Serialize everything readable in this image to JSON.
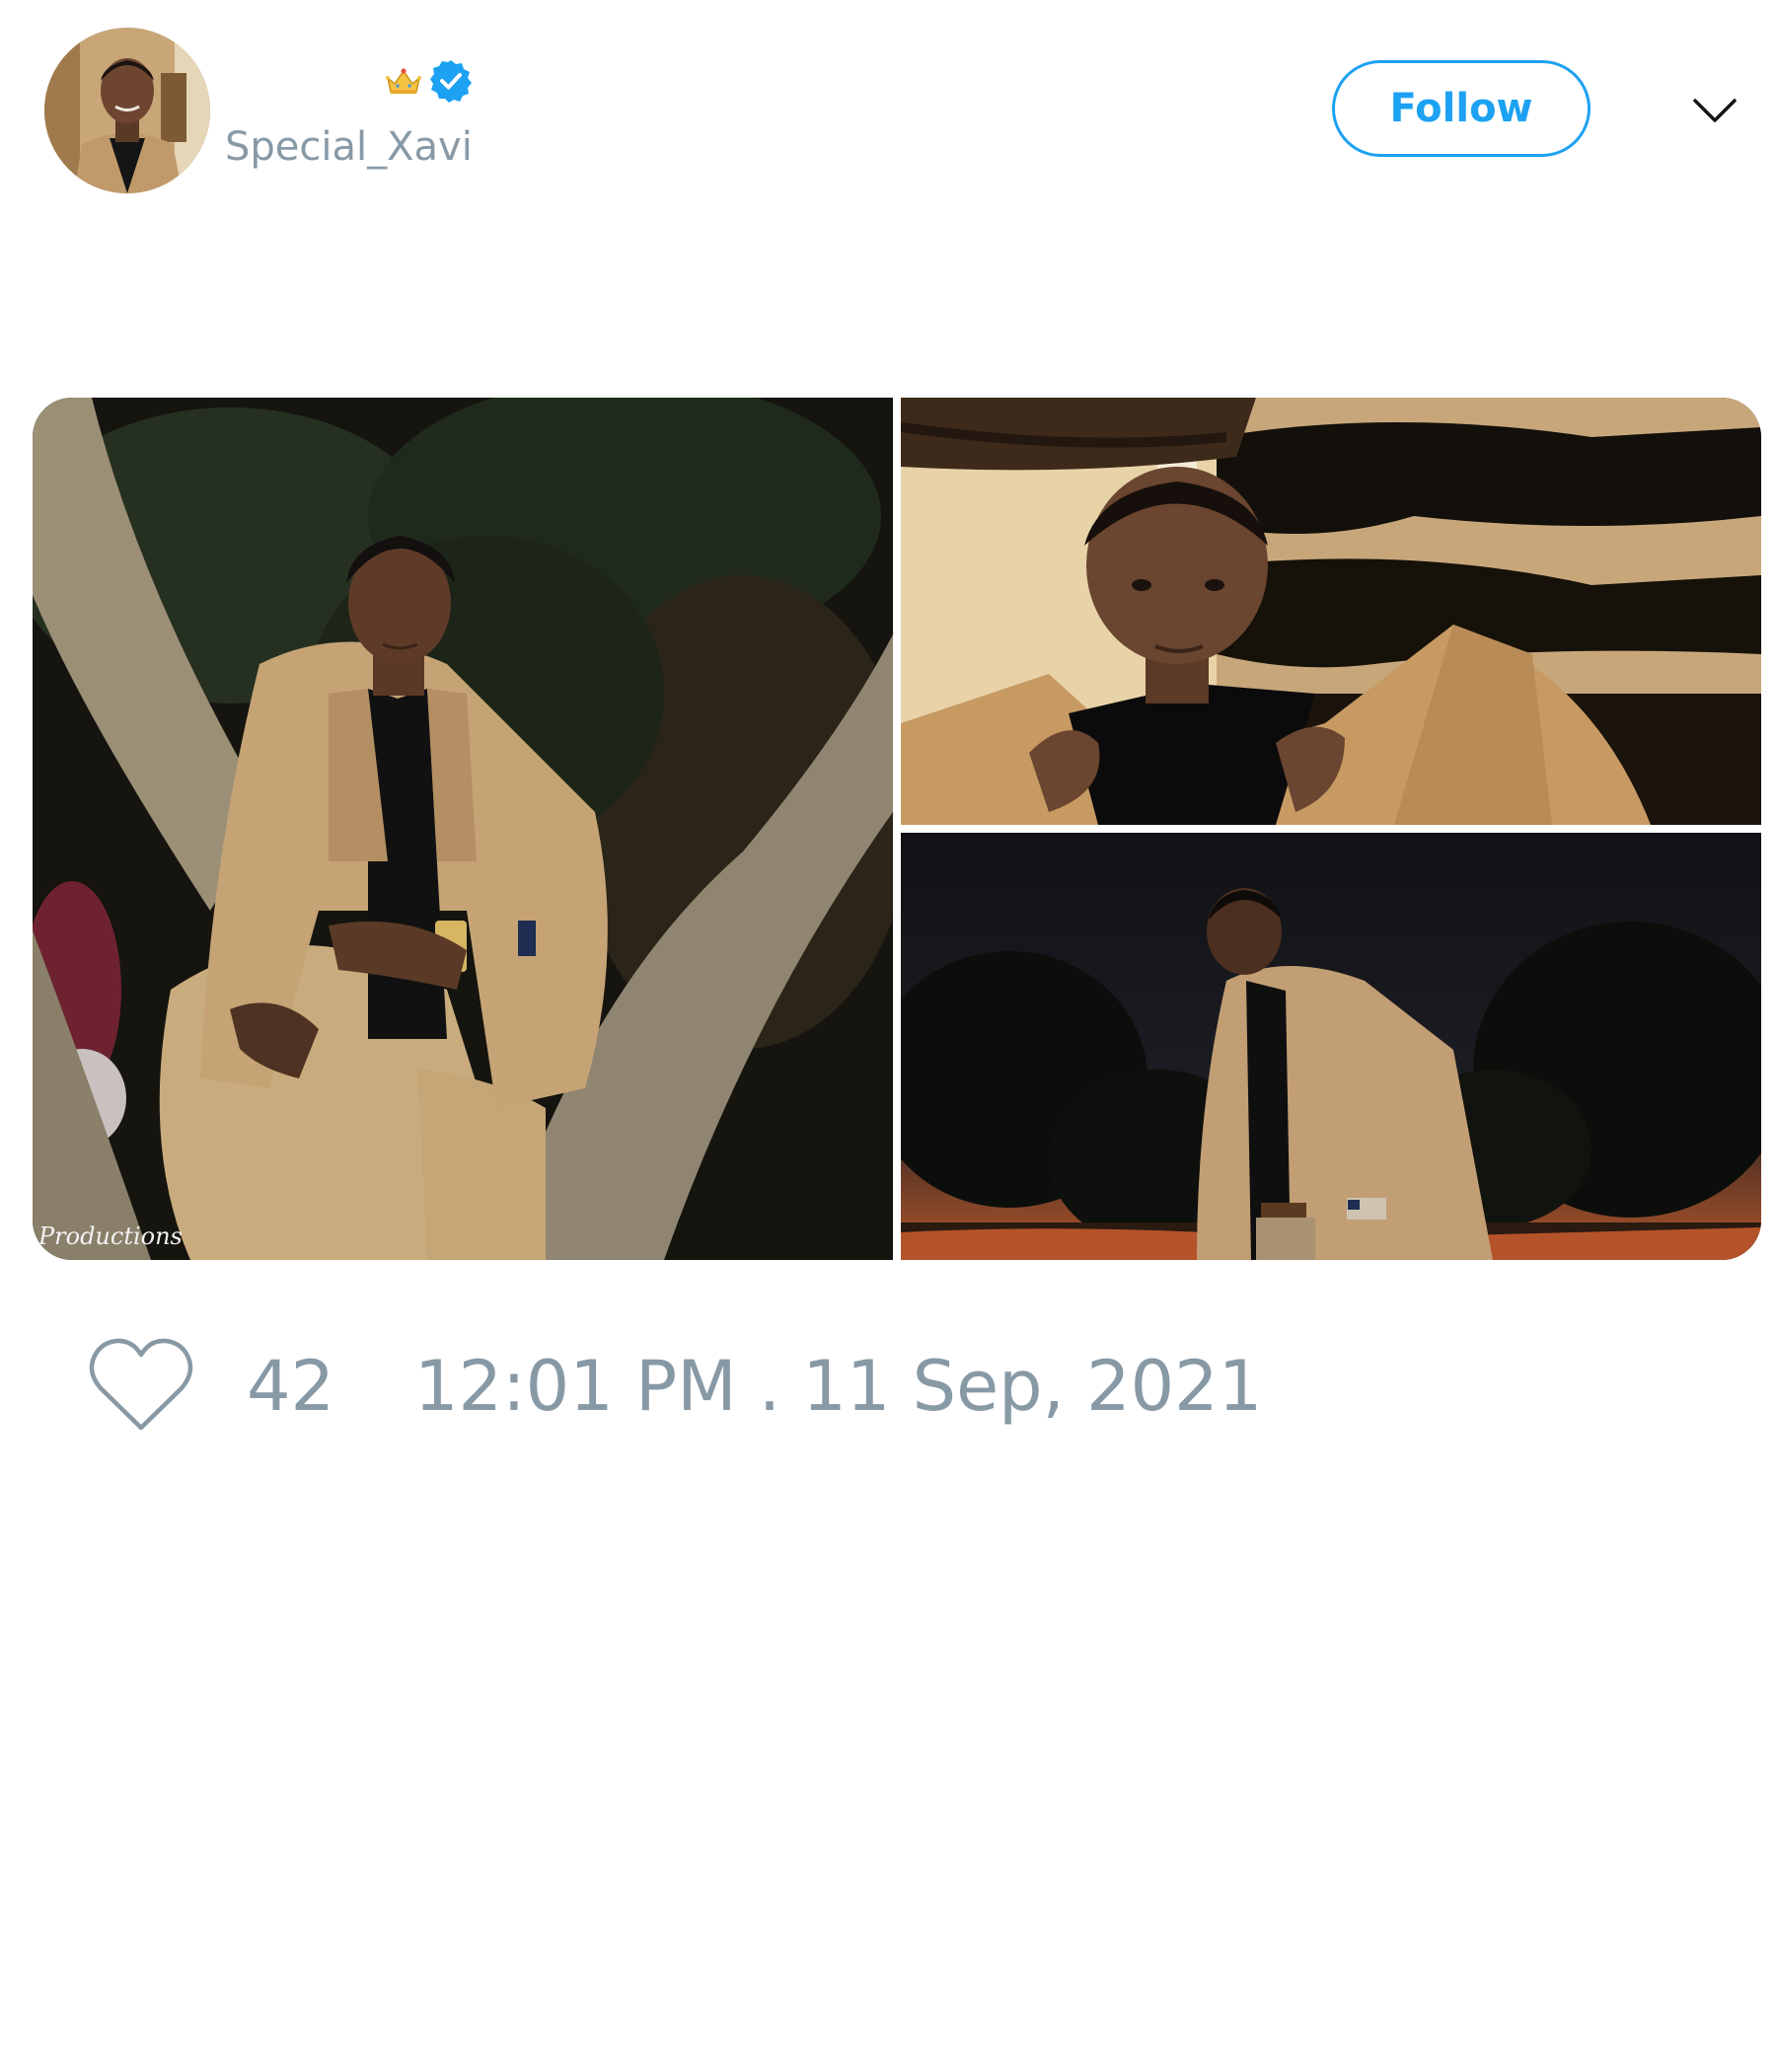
{
  "author": {
    "display_name": "",
    "handle": "Special_Xavi",
    "badges": [
      "crown-icon",
      "verified-icon"
    ],
    "avatar_image": "profile photo of man in camel coat and black turtleneck"
  },
  "header": {
    "follow_label": "Follow",
    "menu_icon": "chevron-down-icon"
  },
  "media": {
    "count": 3,
    "photos": [
      {
        "description": "man in camel coat sitting in a tree at night",
        "watermark": "Productions"
      },
      {
        "description": "close-up portrait of man holding coat lapels at sunset"
      },
      {
        "description": "man in camel coat looking down against dusk sky and trees"
      }
    ]
  },
  "footer": {
    "like_icon": "heart-icon",
    "like_count": "42",
    "timestamp": "12:01 PM . 11 Sep, 2021"
  },
  "colors": {
    "accent": "#1da1f2",
    "muted_text": "#8899a6",
    "background": "#ffffff"
  }
}
